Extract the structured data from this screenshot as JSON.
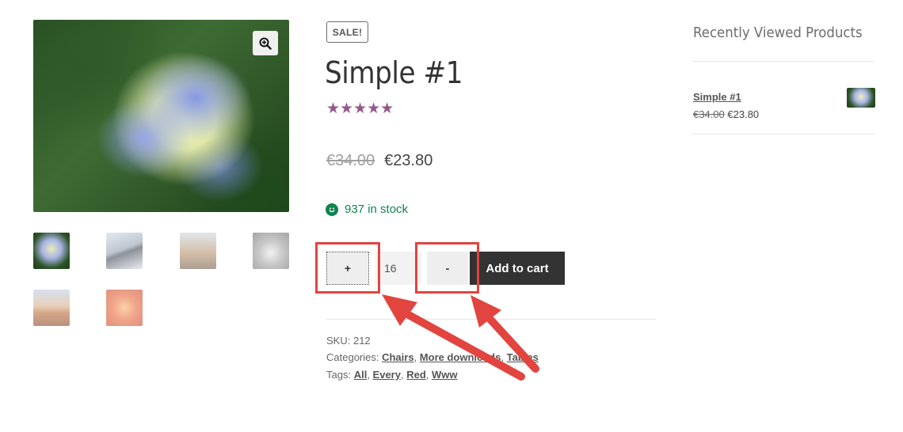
{
  "gallery": {
    "main_image_alt": "Hydrangea flower",
    "zoom_icon": "magnifier-plus-icon",
    "thumbnails": [
      "hydrangea",
      "penguins",
      "lighthouse",
      "koala",
      "desert",
      "chrysanthemum"
    ]
  },
  "product": {
    "badge": "SALE!",
    "title": "Simple #1",
    "rating_stars": 5,
    "star_glyph": "★★★★★",
    "old_price": "€34.00",
    "new_price": "€23.80",
    "stock_icon": "smiley-icon",
    "stock": "937 in stock",
    "qty_plus": "+",
    "qty_value": "16",
    "qty_minus": "-",
    "add_to_cart": "Add to cart"
  },
  "meta": {
    "sku_label": "SKU: ",
    "sku": "212",
    "categories_label": "Categories: ",
    "categories": [
      "Chairs",
      "More downloads",
      "Tables"
    ],
    "tags_label": "Tags: ",
    "tags": [
      "All",
      "Every",
      "Red",
      "Www"
    ],
    "separator": ", "
  },
  "sidebar": {
    "title": "Recently Viewed Products",
    "items": [
      {
        "name": "Simple #1",
        "old_price": "€34.00",
        "new_price": "€23.80"
      }
    ]
  },
  "colors": {
    "accent_purple": "#96588a",
    "stock_green": "#0f834d",
    "button_dark": "#333333",
    "highlight_red": "#e2443f"
  }
}
